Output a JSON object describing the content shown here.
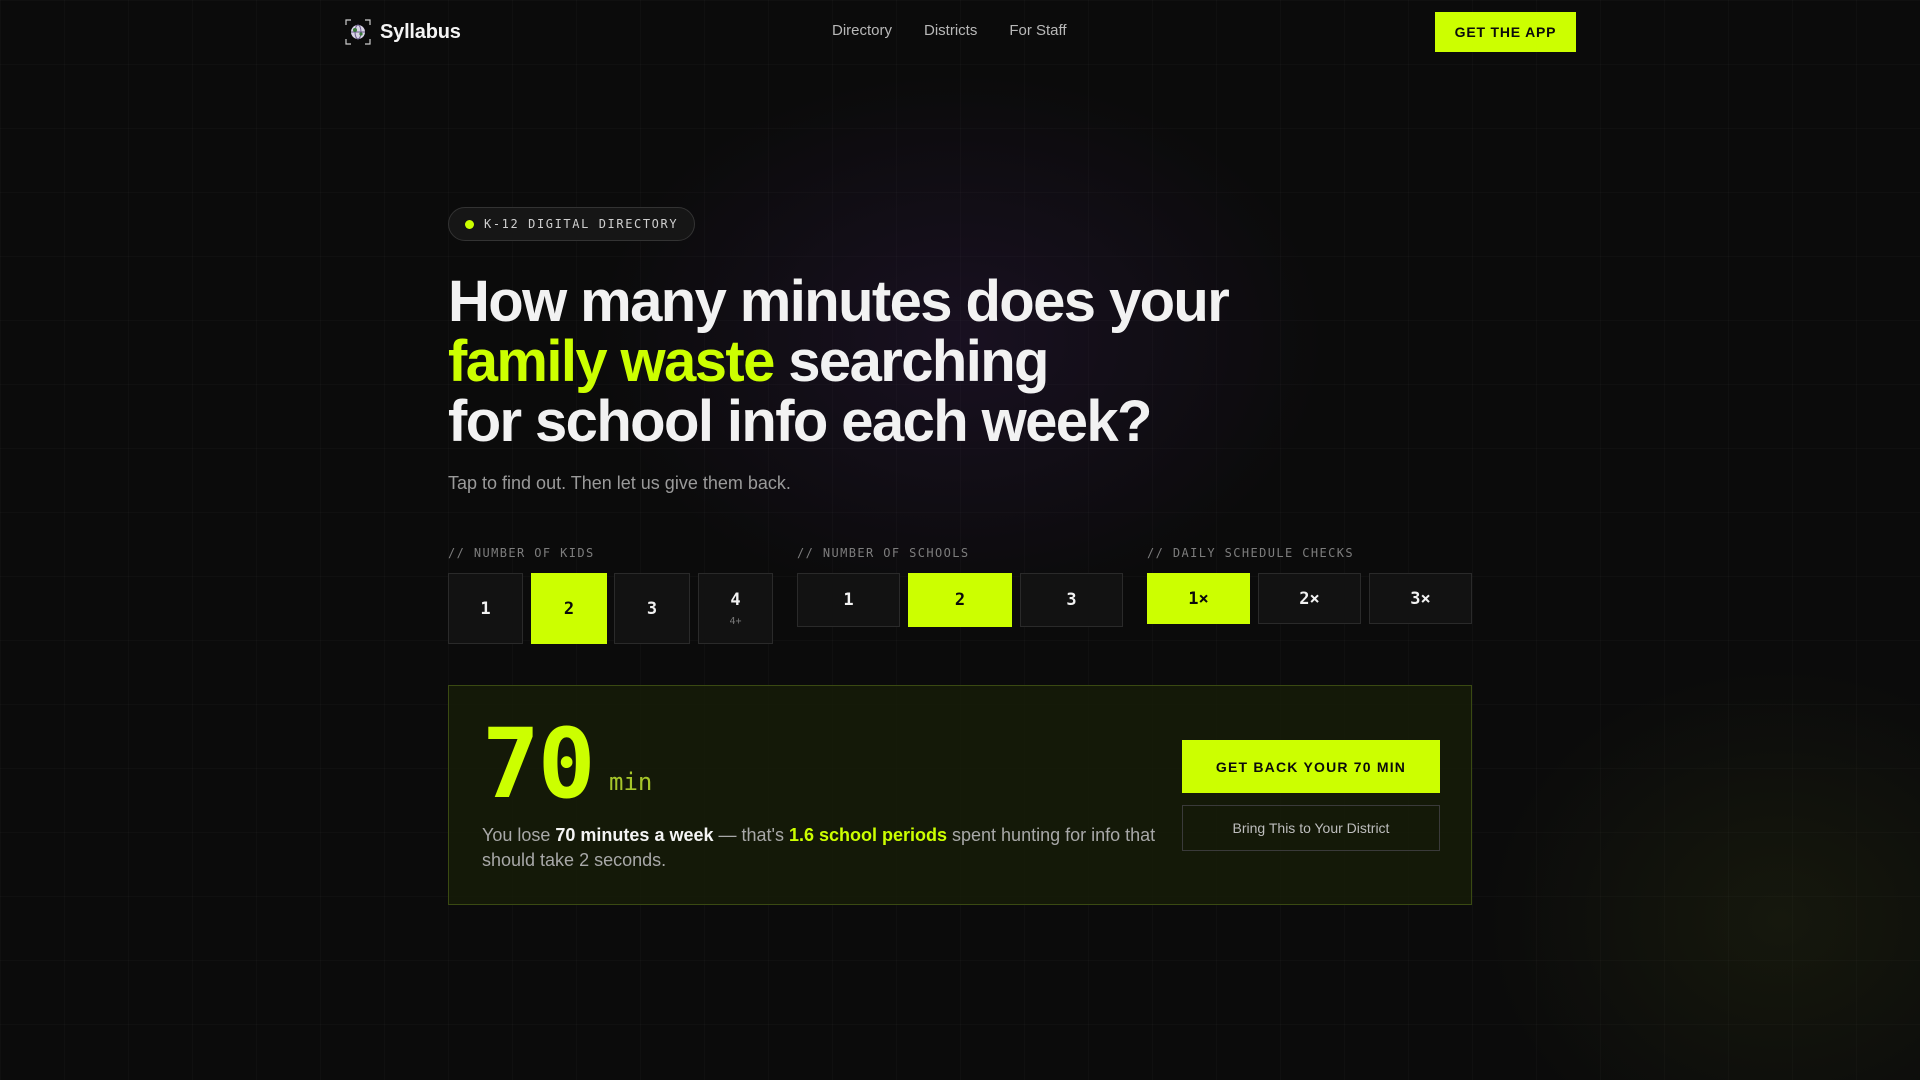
{
  "nav": {
    "brand": "Syllabus",
    "brand_icon": "globe-logo-icon",
    "links": [
      "Directory",
      "Districts",
      "For Staff"
    ],
    "cta": "GET THE APP"
  },
  "hero": {
    "badge": "K-12 DIGITAL DIRECTORY",
    "headline_line1": "How many minutes does your",
    "headline_highlight": "family waste",
    "headline_line2_rest": " searching",
    "headline_line3": "for school info each week?",
    "subtitle": "Tap to find out. Then let us give them back."
  },
  "selectors": {
    "kids": {
      "label": "// NUMBER OF KIDS",
      "options": [
        {
          "value": "1",
          "sub": ""
        },
        {
          "value": "2",
          "sub": ""
        },
        {
          "value": "3",
          "sub": ""
        },
        {
          "value": "4",
          "sub": "4+"
        }
      ],
      "selected": "2"
    },
    "schools": {
      "label": "// NUMBER OF SCHOOLS",
      "options": [
        "1",
        "2",
        "3"
      ],
      "selected": "2"
    },
    "checks": {
      "label": "// DAILY SCHEDULE CHECKS",
      "options": [
        "1×",
        "2×",
        "3×"
      ],
      "selected": "1×"
    }
  },
  "result": {
    "minutes": "70",
    "unit": "min",
    "text_pre": "You lose ",
    "text_minutes": "70 minutes a week",
    "text_mid": " — that's ",
    "text_periods": "1.6 school periods",
    "text_post": " spent hunting for info that should take 2 seconds.",
    "cta_main": "GET BACK YOUR 70 MIN",
    "cta_secondary": "Bring This to Your District"
  },
  "colors": {
    "accent": "#ccff00",
    "background": "#0b0b0b"
  }
}
